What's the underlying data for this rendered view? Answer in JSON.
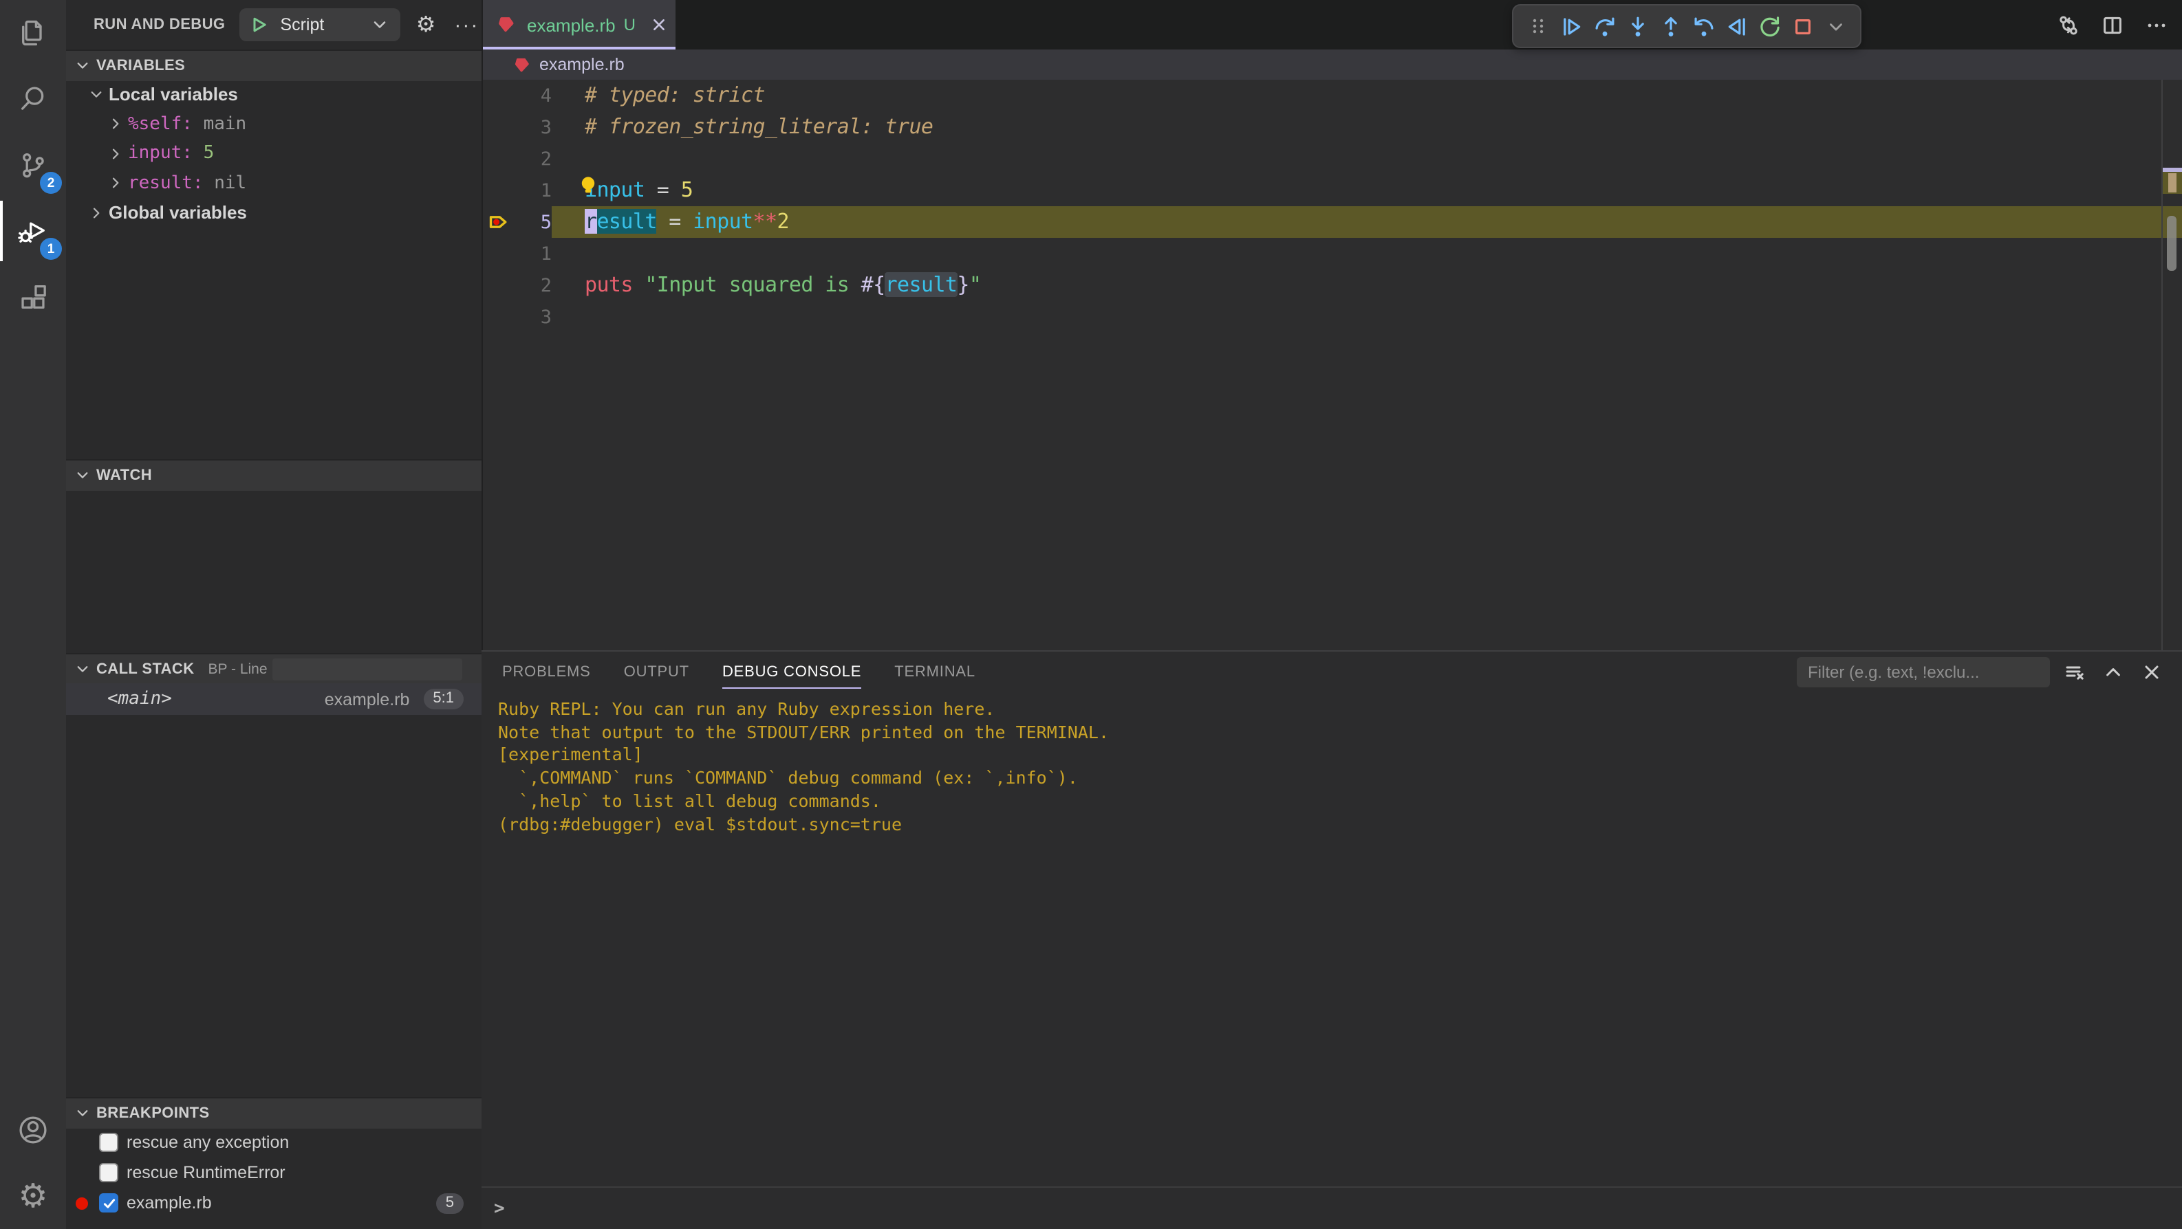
{
  "colors": {
    "badge_blue": "#2f81d7",
    "tab_modified_green": "#6fce96",
    "active_tab_underline": "#c3bdf5",
    "breakpoint_red": "#e51400",
    "current_line_olive": "#5c5827",
    "selection_teal": "#135c66",
    "cursor_lavender": "#cabdf1",
    "console_yellow": "#c9a227",
    "comment_tan": "#c3a373",
    "variable_cyan": "#38c0e8",
    "number_yellow": "#e5d96e",
    "keyword_red": "#e8606e",
    "string_green": "#78c379"
  },
  "activity_bar": {
    "items": [
      {
        "name": "explorer",
        "icon": "explorer-icon"
      },
      {
        "name": "search",
        "icon": "search-icon"
      },
      {
        "name": "source-control",
        "icon": "source-control-icon",
        "badge": "2"
      },
      {
        "name": "run-and-debug",
        "icon": "debug-icon",
        "badge": "1",
        "active": true
      },
      {
        "name": "extensions",
        "icon": "extensions-icon"
      }
    ],
    "bottom_items": [
      {
        "name": "accounts",
        "icon": "account-icon"
      },
      {
        "name": "settings",
        "icon": "gear-icon"
      }
    ]
  },
  "sidebar": {
    "title": "RUN AND DEBUG",
    "launch": {
      "label": "Script"
    },
    "variables": {
      "header": "VARIABLES",
      "local_group": "Local variables",
      "items": [
        {
          "name": "%self:",
          "value": "main",
          "kind": "plain"
        },
        {
          "name": "input:",
          "value": "5",
          "kind": "number"
        },
        {
          "name": "result:",
          "value": "nil",
          "kind": "plain"
        }
      ],
      "global_group": "Global variables"
    },
    "watch": {
      "header": "WATCH"
    },
    "call_stack": {
      "header": "CALL STACK",
      "note": "BP - Line",
      "frame": {
        "name": "<main>",
        "file": "example.rb",
        "position": "5:1"
      }
    },
    "breakpoints": {
      "header": "BREAKPOINTS",
      "items": [
        {
          "label": "rescue any exception",
          "checked": false,
          "dot": false,
          "badge": ""
        },
        {
          "label": "rescue RuntimeError",
          "checked": false,
          "dot": false,
          "badge": ""
        },
        {
          "label": "example.rb",
          "checked": true,
          "dot": true,
          "badge": "5"
        }
      ]
    }
  },
  "editor": {
    "tab": {
      "file": "example.rb",
      "git_status": "U"
    },
    "breadcrumb": {
      "file": "example.rb"
    },
    "debug_toolbar": [
      "drag-gripper",
      "continue",
      "step-over",
      "step-into",
      "step-out",
      "step-back",
      "reverse-continue",
      "restart",
      "stop",
      "toolbar-dropdown"
    ],
    "actions": [
      "open-changes",
      "split-editor",
      "more-actions"
    ],
    "code_lines": [
      {
        "num": "4",
        "tokens": [
          {
            "t": "# typed: strict",
            "c": "cm"
          }
        ]
      },
      {
        "num": "3",
        "tokens": [
          {
            "t": "# frozen_string_literal: true",
            "c": "cm"
          }
        ]
      },
      {
        "num": "2",
        "tokens": []
      },
      {
        "num": "1",
        "lightbulb": true,
        "tokens": [
          {
            "t": "input",
            "c": "v"
          },
          {
            "t": " = ",
            "c": "o"
          },
          {
            "t": "5",
            "c": "n"
          }
        ]
      },
      {
        "num": "5",
        "active": true,
        "breakpoint": true,
        "tokens": [
          {
            "t": "r",
            "c": "v",
            "cursor": true
          },
          {
            "t": "esult",
            "c": "v",
            "hl": "sel"
          },
          {
            "t": " = ",
            "c": "o"
          },
          {
            "t": "input",
            "c": "v"
          },
          {
            "t": "**",
            "c": "k"
          },
          {
            "t": "2",
            "c": "n"
          }
        ]
      },
      {
        "num": "1",
        "tokens": []
      },
      {
        "num": "2",
        "tokens": [
          {
            "t": "puts",
            "c": "k"
          },
          {
            "t": " ",
            "c": "o"
          },
          {
            "t": "\"Input squared is ",
            "c": "s"
          },
          {
            "t": "#{",
            "c": "ip"
          },
          {
            "t": "result",
            "c": "v",
            "hl": "word"
          },
          {
            "t": "}",
            "c": "ip"
          },
          {
            "t": "\"",
            "c": "s"
          }
        ]
      },
      {
        "num": "3",
        "tokens": []
      }
    ]
  },
  "panel": {
    "tabs": [
      {
        "label": "PROBLEMS",
        "active": false
      },
      {
        "label": "OUTPUT",
        "active": false
      },
      {
        "label": "DEBUG CONSOLE",
        "active": true
      },
      {
        "label": "TERMINAL",
        "active": false
      }
    ],
    "filter_placeholder": "Filter (e.g. text, !exclu...",
    "console_lines": [
      "Ruby REPL: You can run any Ruby expression here.",
      "Note that output to the STDOUT/ERR printed on the TERMINAL.",
      "[experimental]",
      "  `,COMMAND` runs `COMMAND` debug command (ex: `,info`).",
      "  `,help` to list all debug commands.",
      "(rdbg:#debugger) eval $stdout.sync=true"
    ],
    "prompt": ">"
  }
}
